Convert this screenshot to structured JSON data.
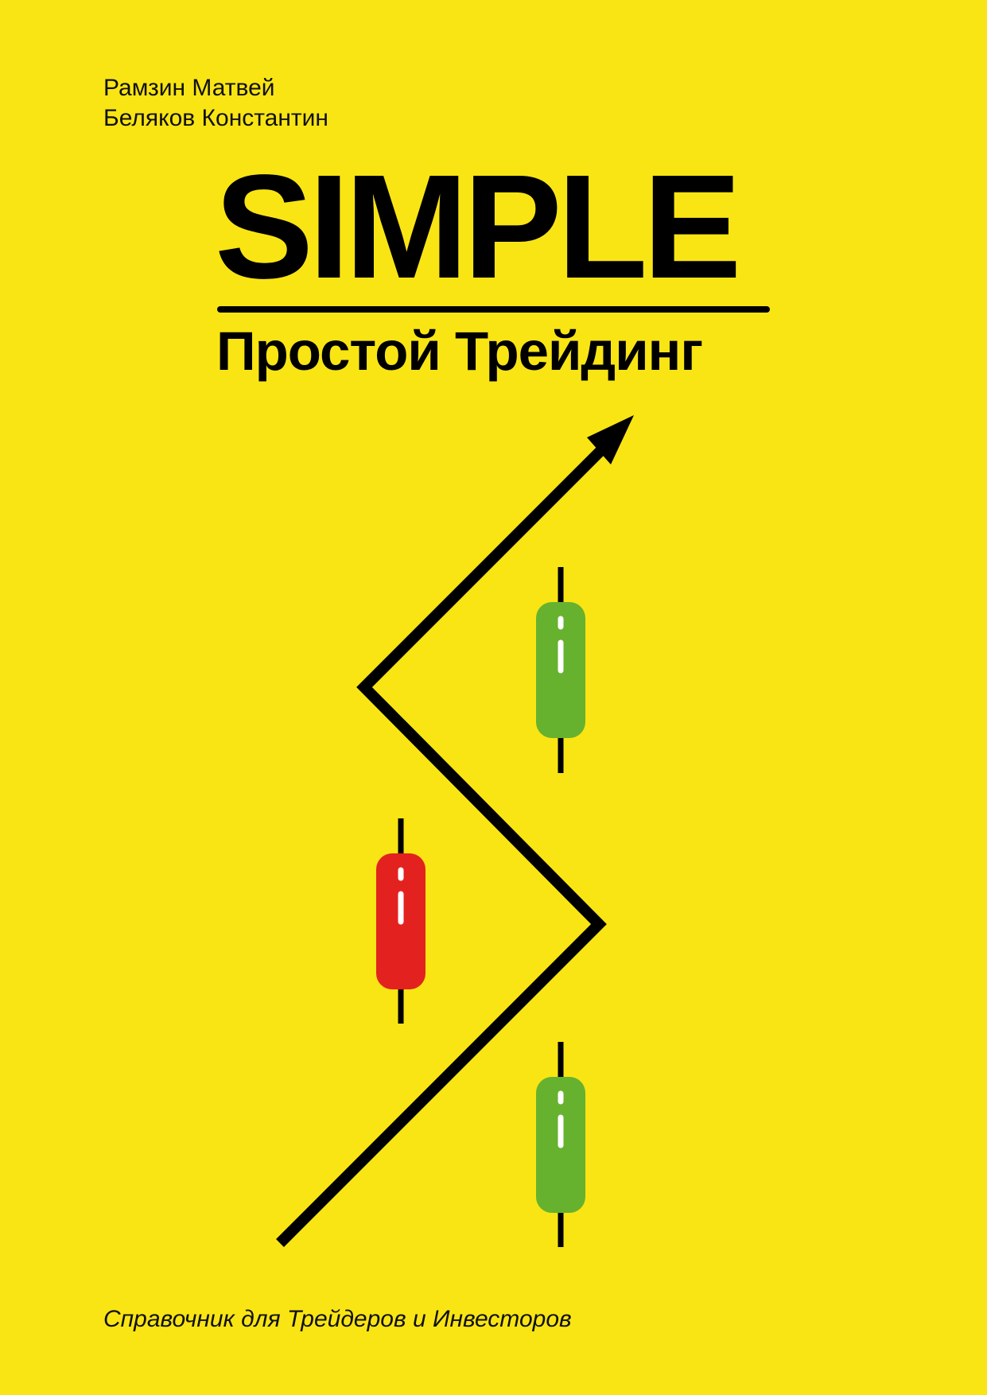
{
  "cover": {
    "background_color": "#F9E514",
    "ink_color": "#000000",
    "authors": [
      "Рамзин Матвей",
      "Беляков Константин"
    ],
    "title": "SIMPLE",
    "subtitle": "Простой Трейдинг",
    "tagline": "Справочник для Трейдеров и Инвесторов"
  },
  "illustration": {
    "trend_arrow_icon": "trend-arrow-icon",
    "candles": [
      {
        "name": "green-candle-top",
        "color": "#66B22E",
        "icon": "bullish-candle-icon"
      },
      {
        "name": "red-candle-middle",
        "color": "#E32220",
        "icon": "bearish-candle-icon"
      },
      {
        "name": "green-candle-bottom",
        "color": "#66B22E",
        "icon": "bullish-candle-icon"
      }
    ],
    "candle_highlight_color": "#FFFFFF"
  }
}
